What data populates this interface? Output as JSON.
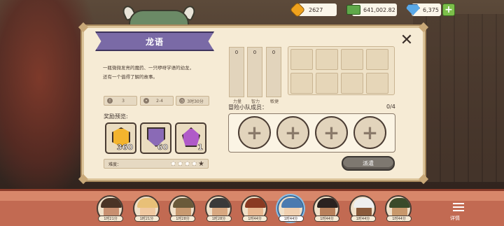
{
  "hud": {
    "gold": "2627",
    "cash": "641,002.82",
    "gems": "6,375",
    "plus_label": "+"
  },
  "dialog": {
    "title": "龙语",
    "description_line1": "一瓶微微发亮的魔药、一只咿呀学语的幼龙，",
    "description_line2": "还有一个值得了解的故事。",
    "close_label": "✕",
    "stats": [
      {
        "icon": "warning-icon",
        "value": "3"
      },
      {
        "icon": "party-icon",
        "value": "2-4"
      },
      {
        "icon": "clock-icon",
        "value": "3时30分"
      }
    ],
    "reward_label": "奖励预览:",
    "rewards": [
      {
        "icon": "gold-gem-icon",
        "count": "360"
      },
      {
        "icon": "shield-badge-icon",
        "count": "60"
      },
      {
        "icon": "purple-gem-icon",
        "count": "1"
      }
    ],
    "difficulty_label": "难度：",
    "difficulty_filled": 1,
    "difficulty_max": 5,
    "attributes": [
      {
        "label": "力量",
        "value": "0"
      },
      {
        "label": "智力",
        "value": "0"
      },
      {
        "label": "敏捷",
        "value": "0"
      }
    ],
    "team_label": "冒险小队成员：",
    "team_count": "0/4",
    "add_member_label": "+",
    "dispatch_label": "派遣"
  },
  "heroes": [
    {
      "time": "1时21分",
      "hair": "#4a3426",
      "skin": "#c89070"
    },
    {
      "time": "1时21分",
      "hair": "#e8c078",
      "skin": "#f0c8a0"
    },
    {
      "time": "1时28分",
      "hair": "#6a5a3a",
      "skin": "#c89a70"
    },
    {
      "time": "1时28分",
      "hair": "#3a3a3a",
      "skin": "#d8a880"
    },
    {
      "time": "1时44分",
      "hair": "#8a3a22",
      "skin": "#e8b890"
    },
    {
      "time": "1时44分",
      "hair": "#4a7ab0",
      "skin": "#f0d0b0",
      "selected": true
    },
    {
      "time": "1时44分",
      "hair": "#2a2220",
      "skin": "#b8805a"
    },
    {
      "time": "1时44分",
      "hair": "#eeeeee",
      "skin": "#8a5a3a"
    },
    {
      "time": "1时44分",
      "hair": "#3a4a2a",
      "skin": "#c8986a"
    }
  ],
  "menu_label": "详情"
}
